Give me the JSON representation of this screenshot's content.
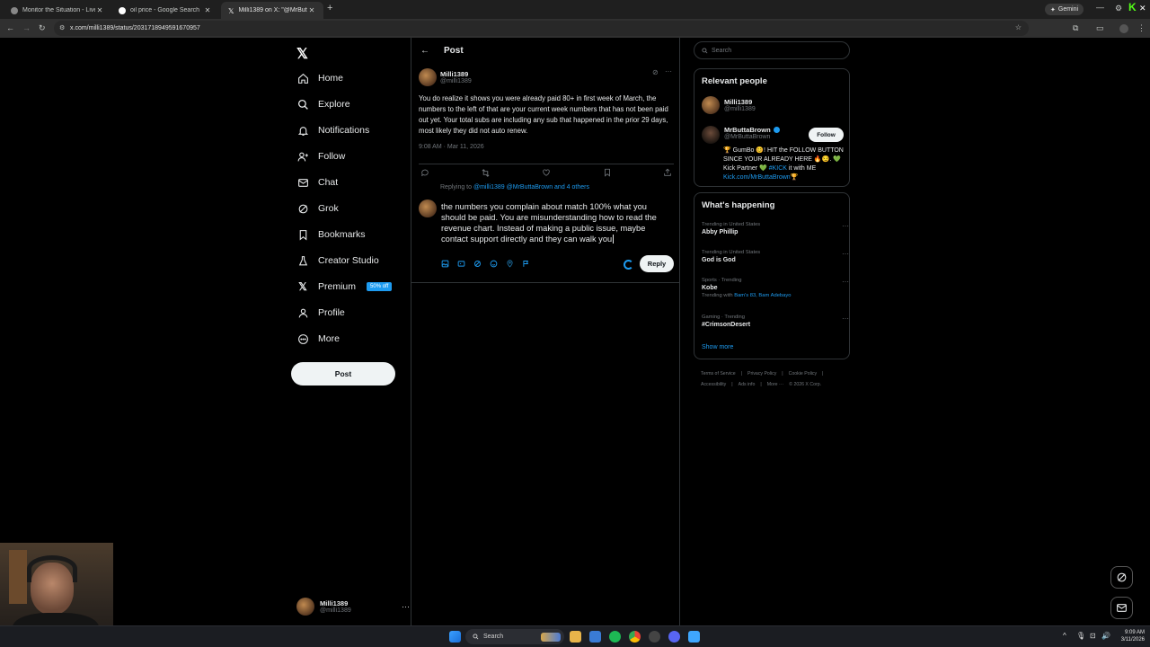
{
  "browser": {
    "tabs": [
      {
        "title": "Monitor the Situation - Live Gl",
        "active": false
      },
      {
        "title": "oil price - Google Search",
        "active": false
      },
      {
        "title": "Milli1389 on X: \"@MrButtaBrow",
        "active": true
      }
    ],
    "gemini_label": "Gemini",
    "url": "x.com/milli1389/status/2031718949591670957"
  },
  "nav": {
    "items": [
      {
        "label": "Home",
        "icon": "home-icon"
      },
      {
        "label": "Explore",
        "icon": "search-icon"
      },
      {
        "label": "Notifications",
        "icon": "bell-icon"
      },
      {
        "label": "Follow",
        "icon": "add-person-icon"
      },
      {
        "label": "Chat",
        "icon": "mail-icon"
      },
      {
        "label": "Grok",
        "icon": "grok-icon"
      },
      {
        "label": "Bookmarks",
        "icon": "bookmark-icon"
      },
      {
        "label": "Creator Studio",
        "icon": "creator-icon"
      },
      {
        "label": "Premium",
        "icon": "x-icon"
      },
      {
        "label": "Profile",
        "icon": "person-icon"
      },
      {
        "label": "More",
        "icon": "more-circle-icon"
      }
    ],
    "premium_badge": "50% off",
    "post_label": "Post",
    "account": {
      "name": "Milli1389",
      "handle": "@milli1389"
    }
  },
  "main": {
    "header_title": "Post",
    "tweet": {
      "name": "Milli1389",
      "handle": "@milli1389",
      "text": "You do realize it shows you were already paid 80+ in first week of March, the numbers to the left of that are your current week numbers that has not been paid out yet. Your total subs are including any sub that happened in the prior 29 days, most likely they did not auto renew.",
      "time": "9:08 AM · Mar 11, 2026"
    },
    "replying_prefix": "Replying to ",
    "replying_to": "@milli1389 @MrButtaBrown and 4 others",
    "draft": "the numbers you complain about match 100% what you should be paid. You are misunderstanding how to read the revenue chart. Instead of making a public issue, maybe contact support directly and they can walk you",
    "reply_label": "Reply"
  },
  "sidebar": {
    "search_placeholder": "Search",
    "relevant_title": "Relevant people",
    "people": [
      {
        "name": "Milli1389",
        "handle": "@milli1389"
      },
      {
        "name": "MrButtaBrown",
        "handle": "@MrButtaBrown",
        "follow_label": "Follow"
      }
    ],
    "bio_part1": "🏆 GumBo 😊! HIT the FOLLOW BUTTON SINCE YOUR ALREADY HERE 🔥😏. 💚 Kick Partner 💚 ",
    "bio_tag": "#KICK",
    "bio_part2": " it with ME ",
    "bio_link": "Kick.com/MrButtaBrown",
    "bio_end": "🏆",
    "happening_title": "What's happening",
    "trends": [
      {
        "context": "Trending in United States",
        "title": "Abby Phillip",
        "with": ""
      },
      {
        "context": "Trending in United States",
        "title": "God is God",
        "with": ""
      },
      {
        "context": "Sports · Trending",
        "title": "Kobe",
        "with_prefix": "Trending with ",
        "with": "Bam's 83, Bam Adebayo"
      },
      {
        "context": "Gaming · Trending",
        "title": "#CrimsonDesert",
        "with": ""
      }
    ],
    "show_more": "Show more",
    "footer_links": [
      "Terms of Service",
      "|",
      "Privacy Policy",
      "|",
      "Cookie Policy",
      "|",
      "Accessibility",
      "|",
      "Ads info",
      "|",
      "More ···",
      "© 2026 X Corp."
    ]
  },
  "taskbar": {
    "search_label": "Search",
    "time": "9:09 AM",
    "date": "3/11/2026"
  }
}
